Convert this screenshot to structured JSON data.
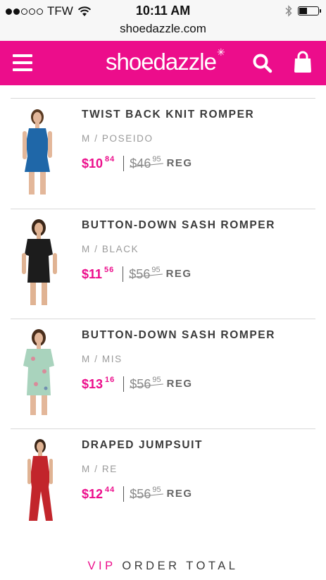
{
  "status_bar": {
    "carrier": "TFW",
    "time": "10:11 AM",
    "url": "shoedazzle.com"
  },
  "header": {
    "logo_text": "shoedazzle",
    "brand_color": "#ec0d8b",
    "icons": [
      "menu-icon",
      "search-icon",
      "shopping-bag-icon"
    ]
  },
  "items": [
    {
      "name": "TWIST BACK KNIT ROMPER",
      "variant": "M / POSEIDO",
      "price_dollars": "$10",
      "price_cents": "84",
      "reg_dollars": "$46",
      "reg_cents": "95",
      "reg_label": "REG",
      "garment_color": "#1f67a8"
    },
    {
      "name": "BUTTON-DOWN SASH ROMPER",
      "variant": "M / BLACK",
      "price_dollars": "$11",
      "price_cents": "56",
      "reg_dollars": "$56",
      "reg_cents": "95",
      "reg_label": "REG",
      "garment_color": "#1c1c1c"
    },
    {
      "name": "BUTTON-DOWN SASH ROMPER",
      "variant": "M / MIS",
      "price_dollars": "$13",
      "price_cents": "16",
      "reg_dollars": "$56",
      "reg_cents": "95",
      "reg_label": "REG",
      "garment_color": "#a9d3bd"
    },
    {
      "name": "DRAPED JUMPSUIT",
      "variant": "M / RE",
      "price_dollars": "$12",
      "price_cents": "44",
      "reg_dollars": "$56",
      "reg_cents": "95",
      "reg_label": "REG",
      "garment_color": "#c2252b"
    }
  ],
  "footer": {
    "vip": "VIP",
    "order_total": "ORDER TOTAL"
  }
}
